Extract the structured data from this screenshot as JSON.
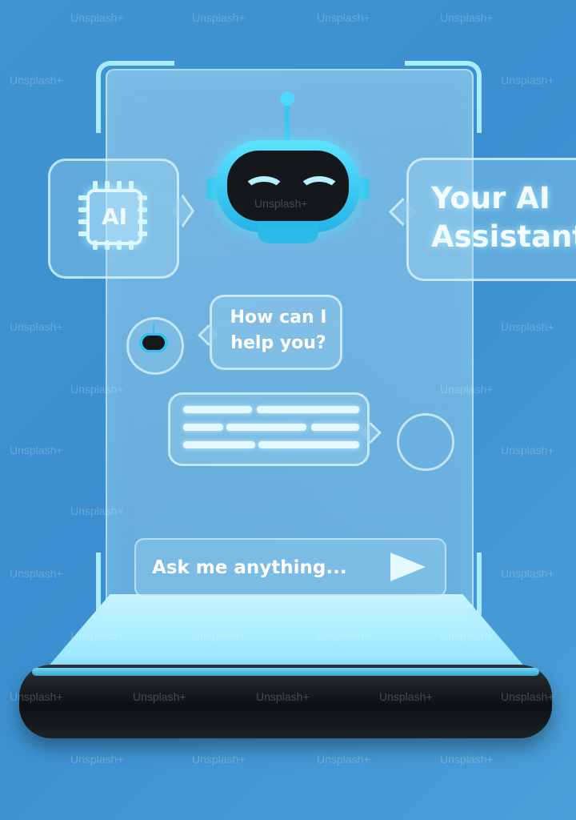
{
  "scene": {
    "ai_chip_label": "AI",
    "title": "Your AI Assistant",
    "title_line1": "Your AI",
    "title_line2": "Assistant",
    "bot_message_line1": "How can I",
    "bot_message_line2": "help you?",
    "input_placeholder": "Ask me anything...",
    "watermark": "Unsplash+"
  },
  "colors": {
    "background": "#3f95d1",
    "robot_accent": "#2fc3ee",
    "visor": "#14181c",
    "glass_outline": "#a9ecff"
  },
  "icons": [
    "ai-chip-icon",
    "robot-icon",
    "send-icon"
  ]
}
